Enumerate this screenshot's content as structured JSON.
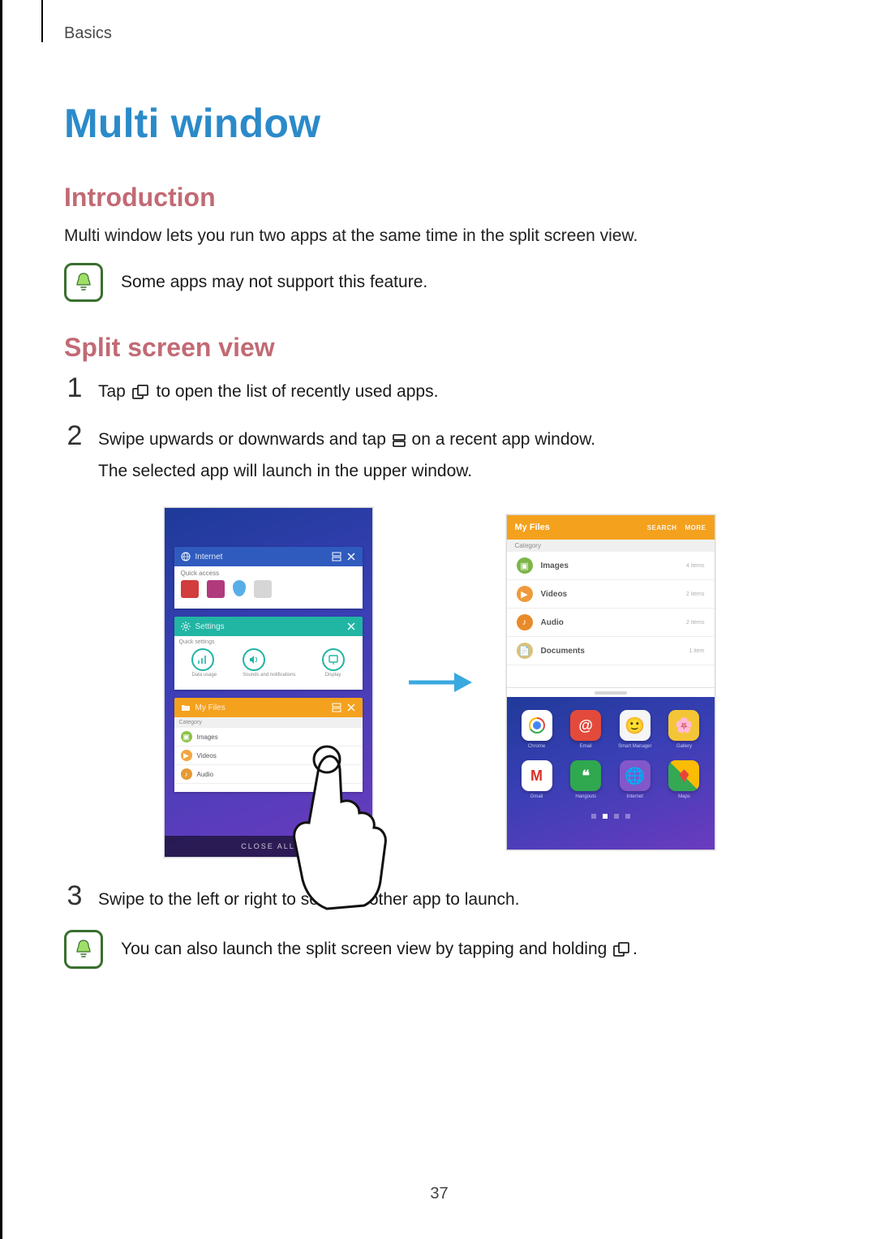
{
  "running_head": "Basics",
  "page_number": "37",
  "title": "Multi window",
  "intro": {
    "heading": "Introduction",
    "body": "Multi window lets you run two apps at the same time in the split screen view.",
    "note": "Some apps may not support this feature."
  },
  "split": {
    "heading": "Split screen view",
    "step1_pre": "Tap ",
    "step1_post": " to open the list of recently used apps.",
    "step2_pre": "Swipe upwards or downwards and tap ",
    "step2_post": " on a recent app window.",
    "step2_line2": "The selected app will launch in the upper window.",
    "step3": "Swipe to the left or right to select another app to launch.",
    "note_pre": "You can also launch the split screen view by tapping and holding ",
    "note_post": "."
  },
  "icons": {
    "recent": "recent-apps-icon",
    "split": "multiwindow-icon"
  },
  "figure": {
    "left": {
      "close_all": "CLOSE ALL",
      "cards": {
        "internet": {
          "title": "Internet",
          "quick": "Quick access"
        },
        "settings": {
          "title": "Settings",
          "section": "Quick settings",
          "items": [
            "Data usage",
            "Sounds and notifications",
            "Display"
          ]
        },
        "files": {
          "title": "My Files",
          "category": "Category",
          "rows": [
            "Images",
            "Videos",
            "Audio"
          ]
        }
      }
    },
    "right": {
      "files": {
        "title": "My Files",
        "search": "SEARCH",
        "more": "MORE",
        "category": "Category",
        "rows": [
          {
            "name": "Images",
            "meta": "4 items"
          },
          {
            "name": "Videos",
            "meta": "2 items"
          },
          {
            "name": "Audio",
            "meta": "2 items"
          },
          {
            "name": "Documents",
            "meta": "1 item"
          }
        ]
      },
      "apps": {
        "row1": [
          "Chrome",
          "Email",
          "Smart Manager",
          "Gallery"
        ],
        "row2": [
          "Gmail",
          "Hangouts",
          "Internet",
          "Maps"
        ]
      }
    }
  }
}
